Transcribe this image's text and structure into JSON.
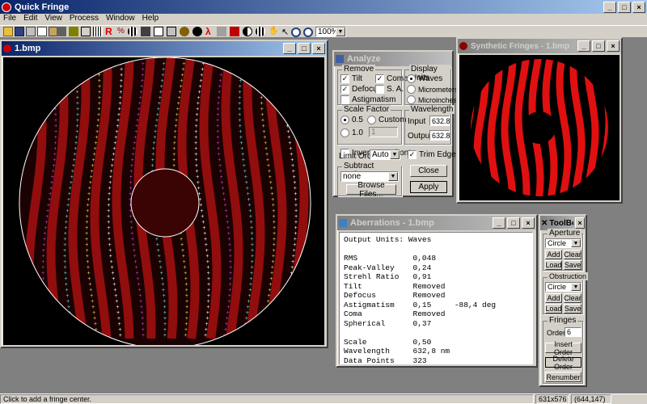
{
  "app": {
    "title": "Quick Fringe"
  },
  "menu": [
    "File",
    "Edit",
    "View",
    "Process",
    "Window",
    "Help"
  ],
  "toolbar": {
    "zoom_value": "100%",
    "red_labels": [
      "R",
      "Z",
      "G"
    ],
    "zoom_symbol": "λ"
  },
  "image_window": {
    "title": "1.bmp"
  },
  "analyze": {
    "title": "Analyze",
    "remove_label": "Remove",
    "tilt": "Tilt",
    "coma": "Coma",
    "defocus": "Defocus",
    "sa": "S. A.",
    "astigmatism": "Astigmatism",
    "display_units_label": "Display Units",
    "waves": "Waves",
    "micrometers": "Micrometers",
    "microinches": "Microinches",
    "scale_factor_label": "Scale Factor",
    "s05": "0.5",
    "custom": "Custom",
    "s10": "1.0",
    "custom_value": "1",
    "invert": "Invert Wavefront",
    "wavelength_label": "Wavelength",
    "input_label": "Input",
    "input_value": "632.8",
    "output_label": "Output",
    "output_value": "632.8",
    "limit_order_label": "Limit Order",
    "limit_order_value": "Auto",
    "trim_edges": "Trim Edges",
    "subtract_label": "Subtract Reference",
    "subtract_value": "none",
    "browse": "Browse Files...",
    "close": "Close",
    "apply": "Apply"
  },
  "synthetic": {
    "title": "Synthetic Fringes - 1.bmp"
  },
  "aberrations": {
    "title": "Aberrations - 1.bmp",
    "lines": [
      "Output Units: Waves",
      "",
      "RMS            0,048",
      "Peak-Valley    0,24",
      "Strehl Ratio   0,91",
      "Tilt           Removed",
      "Defocus        Removed",
      "Astigmatism    0,15     -88,4 deg",
      "Coma           Removed",
      "Spherical      0,37",
      "",
      "Scale          0,50",
      "Wavelength     632,8 nm",
      "Data Points    323"
    ]
  },
  "toolbox": {
    "title": "ToolBox",
    "aperture_label": "Aperture",
    "aperture_value": "Circle",
    "obstruction_label": "Obstruction",
    "obstruction_value": "Circle",
    "add": "Add",
    "clear": "Clear",
    "load": "Load",
    "save": "Save",
    "fringes_label": "Fringes",
    "order_label": "Order",
    "order_value": "6",
    "insert_order": "Insert Order",
    "delete_order": "Delete Order",
    "renumber": "Renumber"
  },
  "status": {
    "message": "Click to add a fringe center.",
    "size": "631x576",
    "coords": "(644,147)"
  },
  "colors": {
    "fringe_red": "#e01010",
    "title_active": "#0a246a"
  }
}
